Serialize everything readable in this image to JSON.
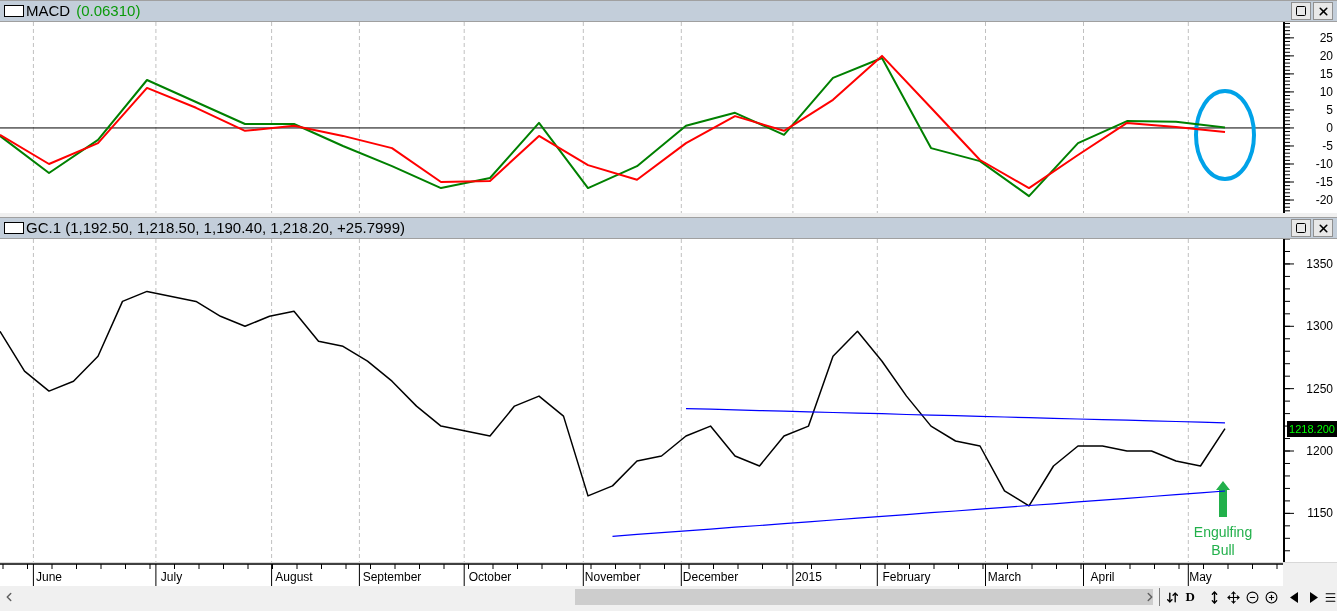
{
  "panels": [
    {
      "kind": "indicator",
      "title": "MACD",
      "value": "(0.06310)",
      "chart_data": {
        "type": "line",
        "ylim": [
          -23.6,
          29.4
        ],
        "yticks": [
          -20,
          -15,
          -10,
          -5,
          0,
          5,
          10,
          15,
          20,
          25
        ],
        "series": [
          {
            "color": "#008000",
            "values": [
              -2.2,
              -12.5,
              -3.3,
              13.3,
              7.2,
              1.1,
              1.1,
              -5,
              -10.6,
              -16.7,
              -13.9,
              1.4,
              -16.7,
              -10.6,
              0.6,
              4.2,
              -1.9,
              13.9,
              19.4,
              -5.6,
              -9.2,
              -18.9,
              -4.2,
              1.9,
              1.7,
              0.1
            ]
          },
          {
            "color": "#ff0000",
            "values": [
              -1.9,
              -10,
              -4.2,
              11.1,
              5.6,
              -0.8,
              0.6,
              -2.2,
              -5.6,
              -15,
              -14.7,
              -2.2,
              -10.3,
              -14.4,
              -4.2,
              3.3,
              -0.8,
              7.8,
              20,
              5.6,
              -8.9,
              -16.7,
              -7.5,
              1.4,
              0.3,
              -1.1
            ]
          }
        ],
        "grid": true
      }
    },
    {
      "kind": "price",
      "title": "GC.1 (1,192.50, 1,218.50, 1,190.40, 1,218.20, +25.7999)",
      "last_price_label": "1218.200",
      "annotation_text": "Engulfing Bull",
      "chart_data": {
        "type": "line",
        "ylim": [
          1111,
          1370
        ],
        "yticks": [
          1150,
          1200,
          1250,
          1300,
          1350
        ],
        "categories": [
          null,
          null,
          "June",
          null,
          null,
          null,
          null,
          "July",
          null,
          null,
          null,
          null,
          "August",
          null,
          null,
          null,
          "September",
          null,
          null,
          null,
          "October",
          null,
          null,
          null,
          null,
          "November",
          null,
          null,
          null,
          "December",
          null,
          null,
          null,
          "2015",
          null,
          null,
          null,
          "February",
          null,
          null,
          null,
          "March",
          null,
          null,
          null,
          "April",
          null,
          null,
          null,
          "May",
          null
        ],
        "series": [
          {
            "color": "#000000",
            "values": [
              1296,
              1264,
              1248,
              1256,
              1276,
              1320,
              1328,
              1324,
              1320,
              1308,
              1300,
              1308,
              1312,
              1288,
              1284,
              1272,
              1256,
              1236,
              1220,
              1216,
              1212,
              1236,
              1244,
              1228,
              1164,
              1172,
              1192,
              1196,
              1212,
              1220,
              1196,
              1188,
              1212,
              1220,
              1276,
              1296,
              1272,
              1244,
              1220,
              1208,
              1204,
              1168,
              1156,
              1188,
              1204,
              1204,
              1200,
              1200,
              1192,
              1188,
              1218
            ]
          },
          {
            "color": "#0000ff",
            "values": [
              null,
              null,
              null,
              null,
              null,
              null,
              null,
              null,
              null,
              null,
              null,
              null,
              null,
              null,
              null,
              null,
              null,
              null,
              null,
              null,
              null,
              null,
              null,
              null,
              null,
              null,
              null,
              null,
              1234,
              1233.5,
              1233,
              1232.4,
              1231.9,
              1231.4,
              1230.9,
              1230.4,
              1229.9,
              1229.3,
              1228.8,
              1228.3,
              1227.8,
              1227.3,
              1226.8,
              1226.2,
              1225.7,
              1225.2,
              1224.7,
              1224.2,
              1223.7,
              1223.1,
              1222.6
            ]
          },
          {
            "color": "#0000ff",
            "values": [
              null,
              null,
              null,
              null,
              null,
              null,
              null,
              null,
              null,
              null,
              null,
              null,
              null,
              null,
              null,
              null,
              null,
              null,
              null,
              null,
              null,
              null,
              null,
              null,
              null,
              1131.6,
              1133.1,
              1134.5,
              1136,
              1137.4,
              1138.9,
              1140.3,
              1141.8,
              1143.2,
              1144.7,
              1146.1,
              1147.6,
              1149,
              1150.5,
              1151.9,
              1153.4,
              1154.8,
              1156.3,
              1157.7,
              1159.2,
              1160.6,
              1162.1,
              1163.5,
              1165,
              1166.4,
              1167.9
            ]
          }
        ],
        "grid": true
      }
    }
  ],
  "toolbar": {
    "period_button": "D"
  }
}
